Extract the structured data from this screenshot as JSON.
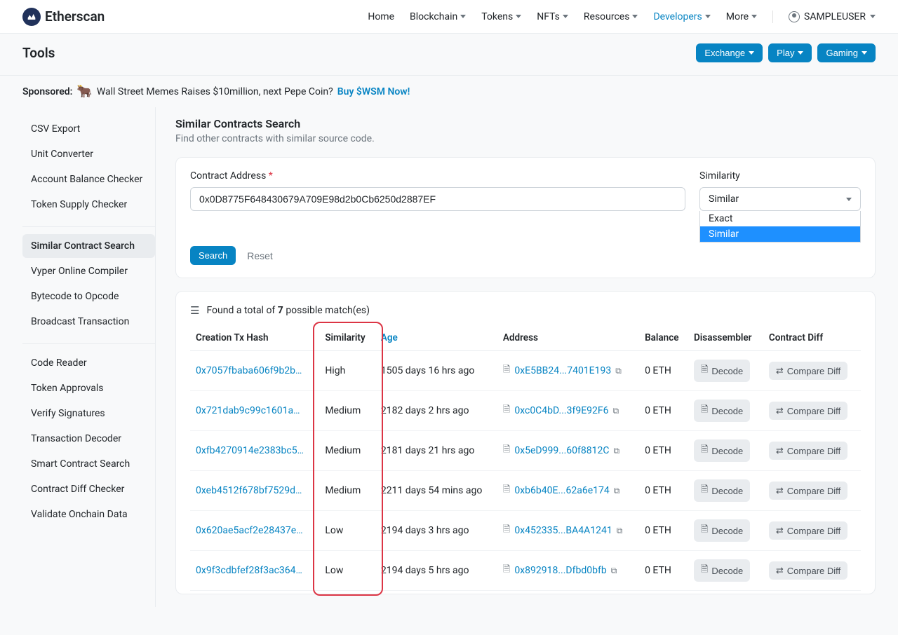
{
  "header": {
    "brand": "Etherscan",
    "nav": [
      "Home",
      "Blockchain",
      "Tokens",
      "NFTs",
      "Resources",
      "Developers",
      "More"
    ],
    "nav_has_chevron": [
      false,
      true,
      true,
      true,
      true,
      true,
      true
    ],
    "nav_active_index": 5,
    "user": "SAMPLEUSER"
  },
  "title": "Tools",
  "quick_buttons": [
    "Exchange",
    "Play",
    "Gaming"
  ],
  "sponsored": {
    "label": "Sponsored:",
    "text": "Wall Street Memes Raises $10million, next Pepe Coin?",
    "cta": "Buy $WSM Now!"
  },
  "sidebar": [
    [
      "CSV Export",
      "Unit Converter",
      "Account Balance Checker",
      "Token Supply Checker"
    ],
    [
      "Similar Contract Search",
      "Vyper Online Compiler",
      "Bytecode to Opcode",
      "Broadcast Transaction"
    ],
    [
      "Code Reader",
      "Token Approvals",
      "Verify Signatures",
      "Transaction Decoder",
      "Smart Contract Search",
      "Contract Diff Checker",
      "Validate Onchain Data"
    ]
  ],
  "sidebar_active": "Similar Contract Search",
  "section": {
    "title": "Similar Contracts Search",
    "subtitle": "Find other contracts with similar source code."
  },
  "form": {
    "addr_label": "Contract Address",
    "addr_value": "0x0D8775F648430679A709E98d2b0Cb6250d2887EF",
    "sim_label": "Similarity",
    "sim_value": "Similar",
    "options": [
      "Exact",
      "Similar"
    ],
    "highlighted_option_index": 1,
    "search": "Search",
    "reset": "Reset"
  },
  "results": {
    "found_prefix": "Found a total of",
    "found_count": "7",
    "found_suffix": "possible match(es)",
    "cols": [
      "Creation Tx Hash",
      "Similarity",
      "Age",
      "Address",
      "Balance",
      "Disassembler",
      "Contract Diff"
    ],
    "decode_label": "Decode",
    "compare_label": "Compare Diff",
    "rows": [
      {
        "hash": "0x7057fbaba606f9b2b…",
        "sim": "High",
        "age": "1505 days 16 hrs ago",
        "addr": "0xE5BB24...7401E193",
        "bal": "0 ETH"
      },
      {
        "hash": "0x721dab9c99c1601a…",
        "sim": "Medium",
        "age": "2182 days 2 hrs ago",
        "addr": "0xc0C4bD...3f9E92F6",
        "bal": "0 ETH"
      },
      {
        "hash": "0xfb4270914e2383bc5…",
        "sim": "Medium",
        "age": "2181 days 21 hrs ago",
        "addr": "0x5eD999...60f8812C",
        "bal": "0 ETH"
      },
      {
        "hash": "0xeb4512f678bf7529d…",
        "sim": "Medium",
        "age": "2211 days 54 mins ago",
        "addr": "0xb6b40E...62a6e174",
        "bal": "0 ETH"
      },
      {
        "hash": "0x620ae5acf2e28437e…",
        "sim": "Low",
        "age": "2194 days 3 hrs ago",
        "addr": "0x452335...BA4A1241",
        "bal": "0 ETH"
      },
      {
        "hash": "0x9f3cdbfef28f3ac364…",
        "sim": "Low",
        "age": "2194 days 5 hrs ago",
        "addr": "0x892918...Dfbd0bfb",
        "bal": "0 ETH"
      }
    ]
  }
}
